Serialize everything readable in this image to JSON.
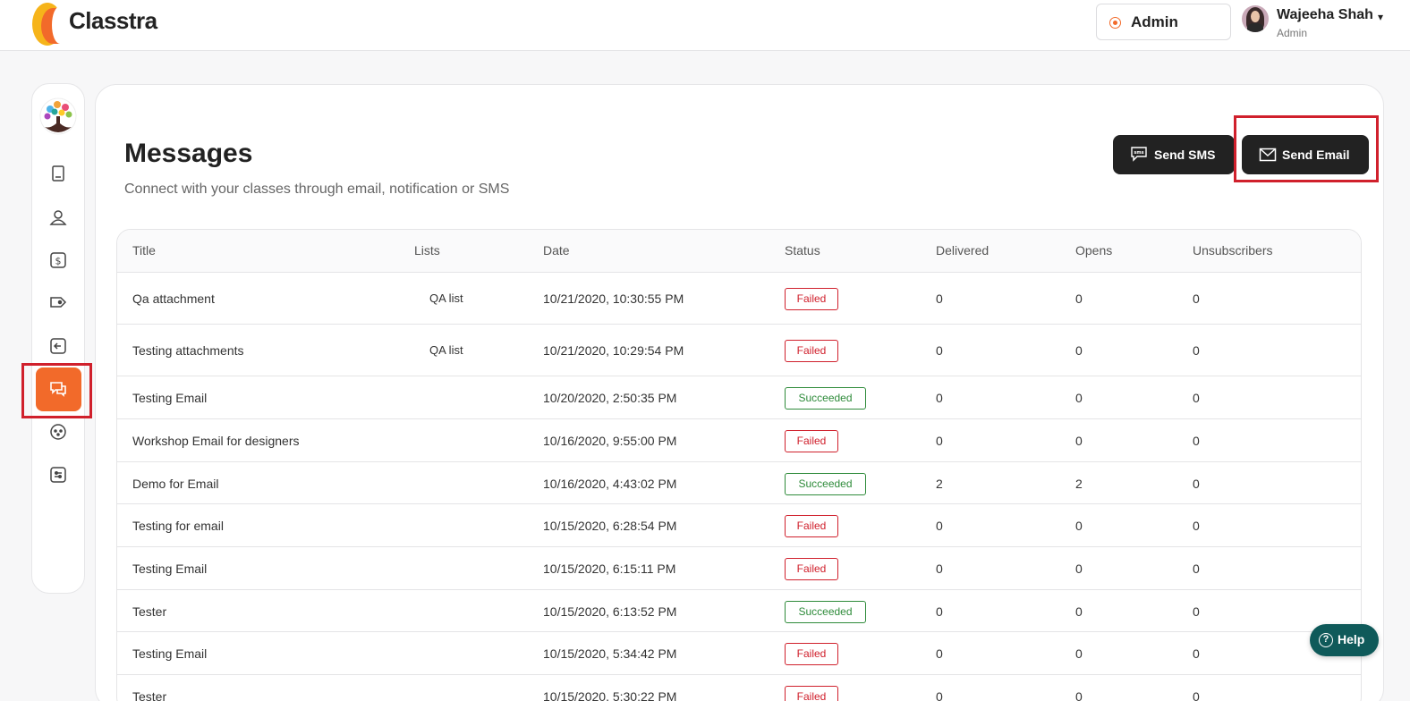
{
  "app": {
    "brand": "Classtra"
  },
  "topbar": {
    "role_label": "Admin",
    "user_name": "Wajeeha Shah",
    "user_role": "Admin",
    "caret": "▾"
  },
  "page": {
    "title": "Messages",
    "subtitle": "Connect with your classes through email, notification or SMS"
  },
  "actions": {
    "send_sms": "Send SMS",
    "send_email": "Send Email"
  },
  "table": {
    "columns": [
      "Title",
      "Lists",
      "Date",
      "Status",
      "Delivered",
      "Opens",
      "Unsubscribers"
    ],
    "rows": [
      {
        "title": "Qa attachment",
        "list": "QA list",
        "date": "10/21/2020, 10:30:55 PM",
        "status": "Failed",
        "delivered": "0",
        "opens": "0",
        "unsubscribers": "0"
      },
      {
        "title": "Testing attachments",
        "list": "QA list",
        "date": "10/21/2020, 10:29:54 PM",
        "status": "Failed",
        "delivered": "0",
        "opens": "0",
        "unsubscribers": "0"
      },
      {
        "title": "Testing Email",
        "list": "",
        "date": "10/20/2020, 2:50:35 PM",
        "status": "Succeeded",
        "delivered": "0",
        "opens": "0",
        "unsubscribers": "0"
      },
      {
        "title": "Workshop Email for designers",
        "list": "",
        "date": "10/16/2020, 9:55:00 PM",
        "status": "Failed",
        "delivered": "0",
        "opens": "0",
        "unsubscribers": "0"
      },
      {
        "title": "Demo for Email",
        "list": "",
        "date": "10/16/2020, 4:43:02 PM",
        "status": "Succeeded",
        "delivered": "2",
        "opens": "2",
        "unsubscribers": "0"
      },
      {
        "title": "Testing for email",
        "list": "",
        "date": "10/15/2020, 6:28:54 PM",
        "status": "Failed",
        "delivered": "0",
        "opens": "0",
        "unsubscribers": "0"
      },
      {
        "title": "Testing Email",
        "list": "",
        "date": "10/15/2020, 6:15:11 PM",
        "status": "Failed",
        "delivered": "0",
        "opens": "0",
        "unsubscribers": "0"
      },
      {
        "title": "Tester",
        "list": "",
        "date": "10/15/2020, 6:13:52 PM",
        "status": "Succeeded",
        "delivered": "0",
        "opens": "0",
        "unsubscribers": "0"
      },
      {
        "title": "Testing Email",
        "list": "",
        "date": "10/15/2020, 5:34:42 PM",
        "status": "Failed",
        "delivered": "0",
        "opens": "0",
        "unsubscribers": "0"
      },
      {
        "title": "Tester",
        "list": "",
        "date": "10/15/2020, 5:30:22 PM",
        "status": "Failed",
        "delivered": "0",
        "opens": "0",
        "unsubscribers": "0"
      }
    ]
  },
  "sidebar": {
    "items": [
      {
        "icon": "book-icon"
      },
      {
        "icon": "user-icon"
      },
      {
        "icon": "dollar-icon"
      },
      {
        "icon": "tag-icon"
      },
      {
        "icon": "login-arrow-icon"
      },
      {
        "icon": "chat-icon",
        "active": true
      },
      {
        "icon": "palette-icon"
      },
      {
        "icon": "settings-sliders-icon"
      }
    ]
  },
  "help": {
    "label": "Help"
  },
  "colors": {
    "accent": "#f26a2a",
    "highlight": "#d0202c",
    "failed": "#d0202c",
    "succeeded": "#2e8b3a",
    "help_bg": "#0f5a5a"
  }
}
